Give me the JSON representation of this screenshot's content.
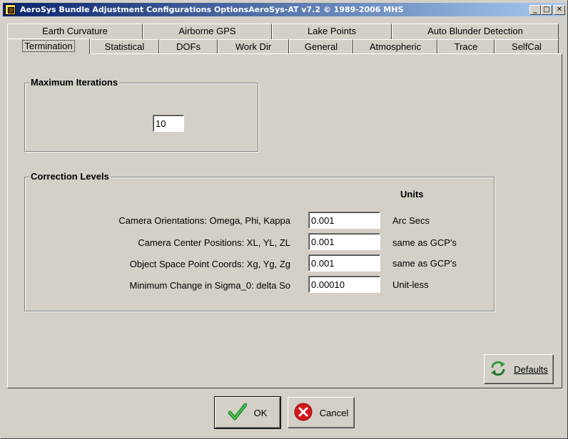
{
  "window": {
    "title": "AeroSys Bundle Adjustment Configurations OptionsAeroSys-AT  v7.2 © 1989-2006 MHS",
    "minimize": "_",
    "maximize": "□",
    "close": "✕"
  },
  "tabs": {
    "row1": [
      "Earth Curvature",
      "Airborne GPS",
      "Lake Points",
      "Auto Blunder Detection"
    ],
    "row2": [
      "Termination",
      "Statistical",
      "DOFs",
      "Work Dir",
      "General",
      "Atmospheric",
      "Trace",
      "SelfCal"
    ],
    "active": "Termination"
  },
  "max_iterations": {
    "title": "Maximum Iterations",
    "value": "10"
  },
  "correction_levels": {
    "title": "Correction Levels",
    "units_header": "Units",
    "rows": [
      {
        "label": "Camera Orientations:  Omega, Phi, Kappa",
        "value": "0.001",
        "unit": "Arc Secs"
      },
      {
        "label": "Camera Center Positions:  XL, YL, ZL",
        "value": "0.001",
        "unit": "same as GCP's"
      },
      {
        "label": "Object Space Point Coords: Xg, Yg, Zg",
        "value": "0.001",
        "unit": "same as GCP's"
      },
      {
        "label": "Minimum Change in Sigma_0:  delta So",
        "value": "0.00010",
        "unit": "Unit-less"
      }
    ]
  },
  "buttons": {
    "defaults": "Defaults",
    "ok": "OK",
    "cancel": "Cancel"
  },
  "icons": {
    "defaults": "refresh-arrows-icon",
    "ok": "checkmark-icon",
    "cancel": "red-x-icon"
  }
}
